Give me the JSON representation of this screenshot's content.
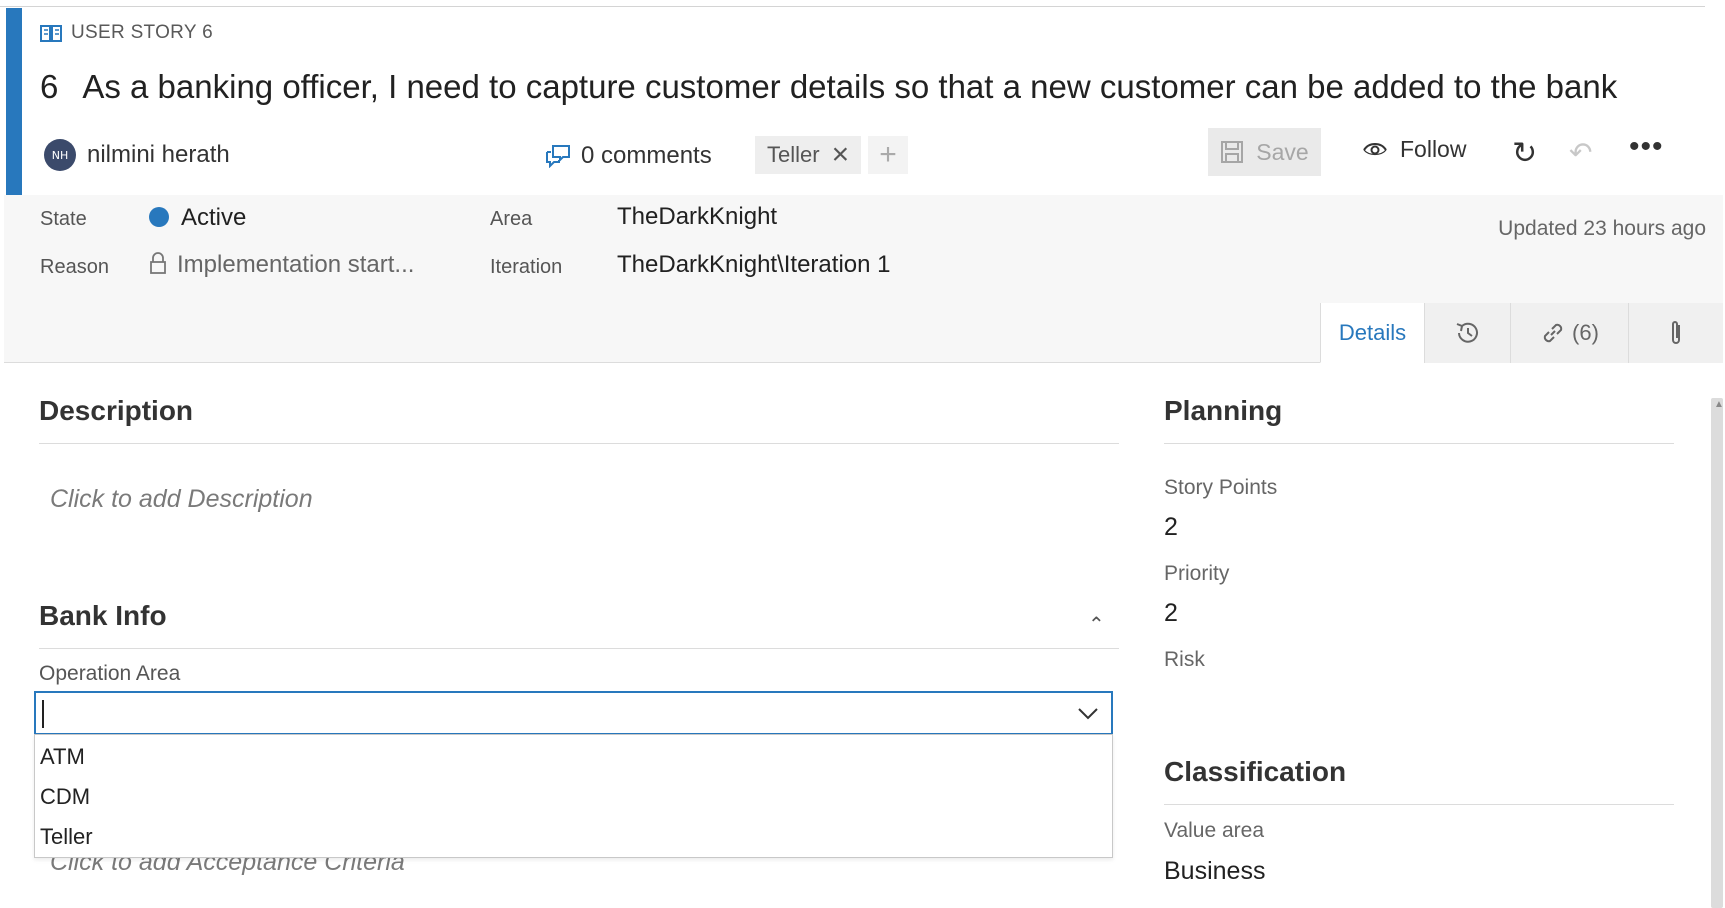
{
  "header": {
    "work_item_type": "USER STORY 6",
    "id": "6",
    "title": "As a banking officer, I need to capture customer details so that a new customer can be added to the bank",
    "owner_initials": "NH",
    "owner_name": "nilmini herath",
    "comments": "0 comments",
    "tag": "Teller",
    "save_label": "Save",
    "follow_label": "Follow"
  },
  "fields": {
    "state_label": "State",
    "state_value": "Active",
    "state_color": "#2878bd",
    "reason_label": "Reason",
    "reason_value": "Implementation start...",
    "area_label": "Area",
    "area_value": "TheDarkKnight",
    "iteration_label": "Iteration",
    "iteration_value": "TheDarkKnight\\Iteration 1",
    "updated": "Updated 23 hours ago"
  },
  "tabs": {
    "details": "Details",
    "links": "(6)"
  },
  "left": {
    "description_title": "Description",
    "description_placeholder": "Click to add Description",
    "bank_info_title": "Bank Info",
    "operation_area_label": "Operation Area",
    "operation_area_value": "",
    "options": [
      "ATM",
      "CDM",
      "Teller"
    ],
    "acceptance_placeholder": "Click to add Acceptance Criteria"
  },
  "right": {
    "planning_title": "Planning",
    "story_points_label": "Story Points",
    "story_points_value": "2",
    "priority_label": "Priority",
    "priority_value": "2",
    "risk_label": "Risk",
    "classification_title": "Classification",
    "value_area_label": "Value area",
    "value_area_value": "Business"
  },
  "colors": {
    "accent": "#2878bd"
  },
  "icons": [
    "book-icon",
    "comment-icon",
    "close-icon",
    "plus-icon",
    "save-icon",
    "eye-icon",
    "refresh-icon",
    "undo-icon",
    "more-icon",
    "lock-icon",
    "history-icon",
    "link-icon",
    "paperclip-icon",
    "chevron-up-icon",
    "chevron-down-icon"
  ]
}
